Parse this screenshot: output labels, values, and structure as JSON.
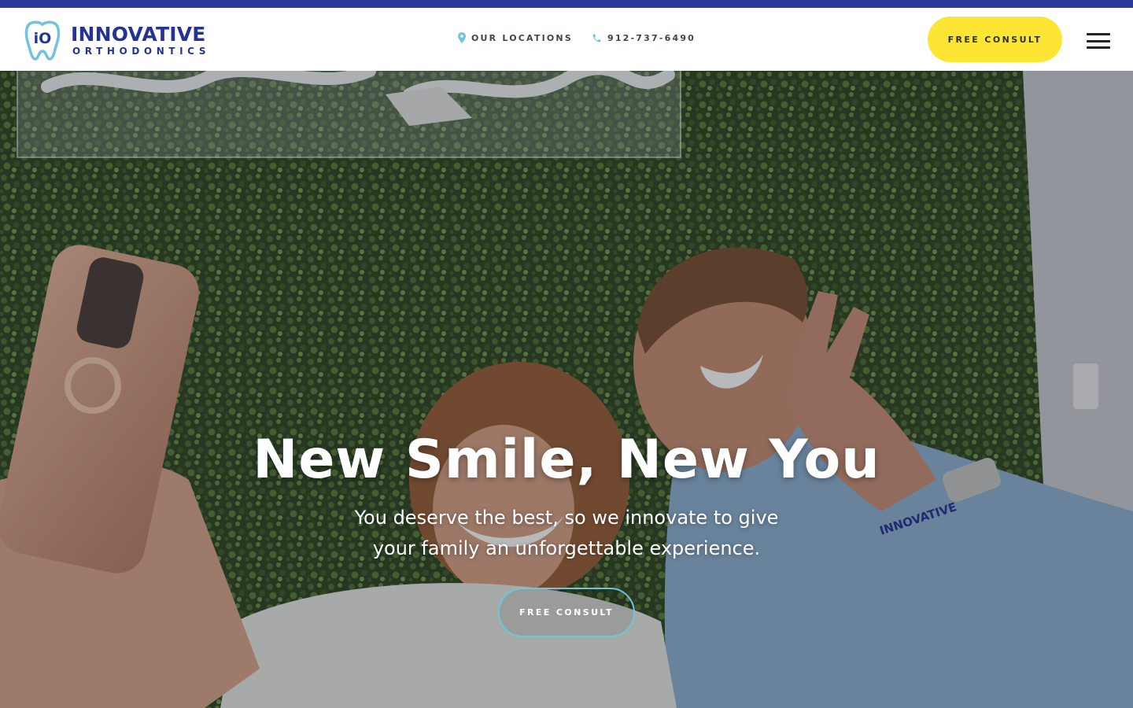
{
  "colors": {
    "brand_navy": "#253494",
    "top_strip": "#2a3b9c",
    "accent_yellow": "#fde633",
    "accent_light_blue": "#72c3dc"
  },
  "header": {
    "logo": {
      "mark": "iO",
      "name": "INNOVATIVE",
      "sub": "ORTHODONTICS"
    },
    "nav": [
      {
        "label": "OUR LOCATIONS",
        "icon": "map-pin-icon"
      },
      {
        "label": "912-737-6490",
        "icon": "phone-icon"
      }
    ],
    "cta_label": "FREE CONSULT",
    "menu_icon": "hamburger-menu-icon"
  },
  "hero": {
    "title": "New Smile, New You",
    "subtitle": "You deserve the best, so we innovate to give your family an unforgettable experience.",
    "cta_label": "FREE CONSULT",
    "shirt_logo": "INNOVATIVE"
  }
}
